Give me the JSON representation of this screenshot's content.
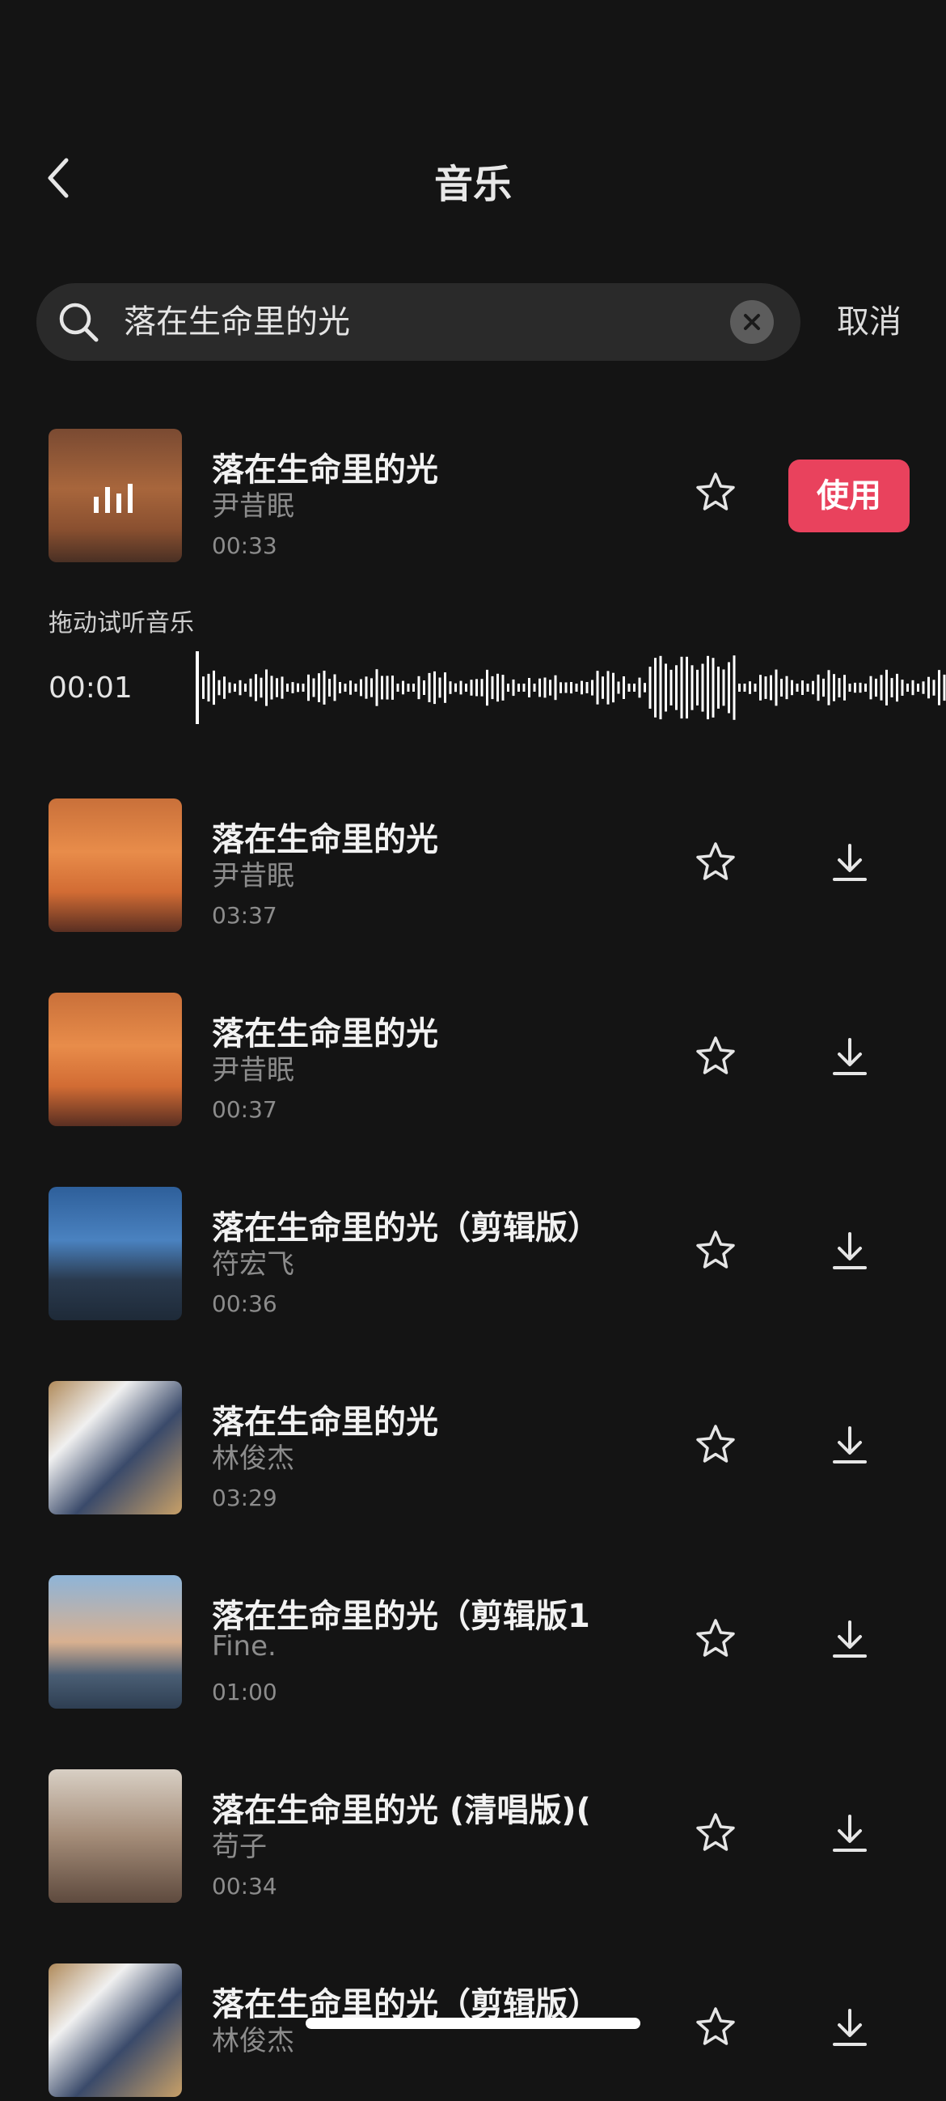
{
  "header": {
    "title": "音乐",
    "back_icon": "chevron-left-icon"
  },
  "search": {
    "query": "落在生命里的光",
    "cancel_label": "取消"
  },
  "active_song": {
    "title": " 落在生命里的光",
    "artist": "尹昔眠",
    "duration": "00:33",
    "use_label": "使用",
    "preview_hint": "拖动试听音乐",
    "preview_time": "00:01",
    "accent_color": "#e9425d"
  },
  "songs": [
    {
      "title": "落在生命里的光",
      "artist": "尹昔眠",
      "duration": "03:37"
    },
    {
      "title": "落在生命里的光",
      "artist": "尹昔眠",
      "duration": "00:37"
    },
    {
      "title": "落在生命里的光（剪辑版）",
      "artist": "符宏飞",
      "duration": "00:36"
    },
    {
      "title": "落在生命里的光",
      "artist": "林俊杰",
      "duration": "03:29"
    },
    {
      "title": "落在生命里的光（剪辑版1",
      "artist": "Fine.",
      "duration": "01:00"
    },
    {
      "title": "落在生命里的光 (清唱版)(",
      "artist": "苟子",
      "duration": "00:34"
    },
    {
      "title": "落在生命里的光（剪辑版）",
      "artist": "林俊杰",
      "duration": ""
    }
  ]
}
